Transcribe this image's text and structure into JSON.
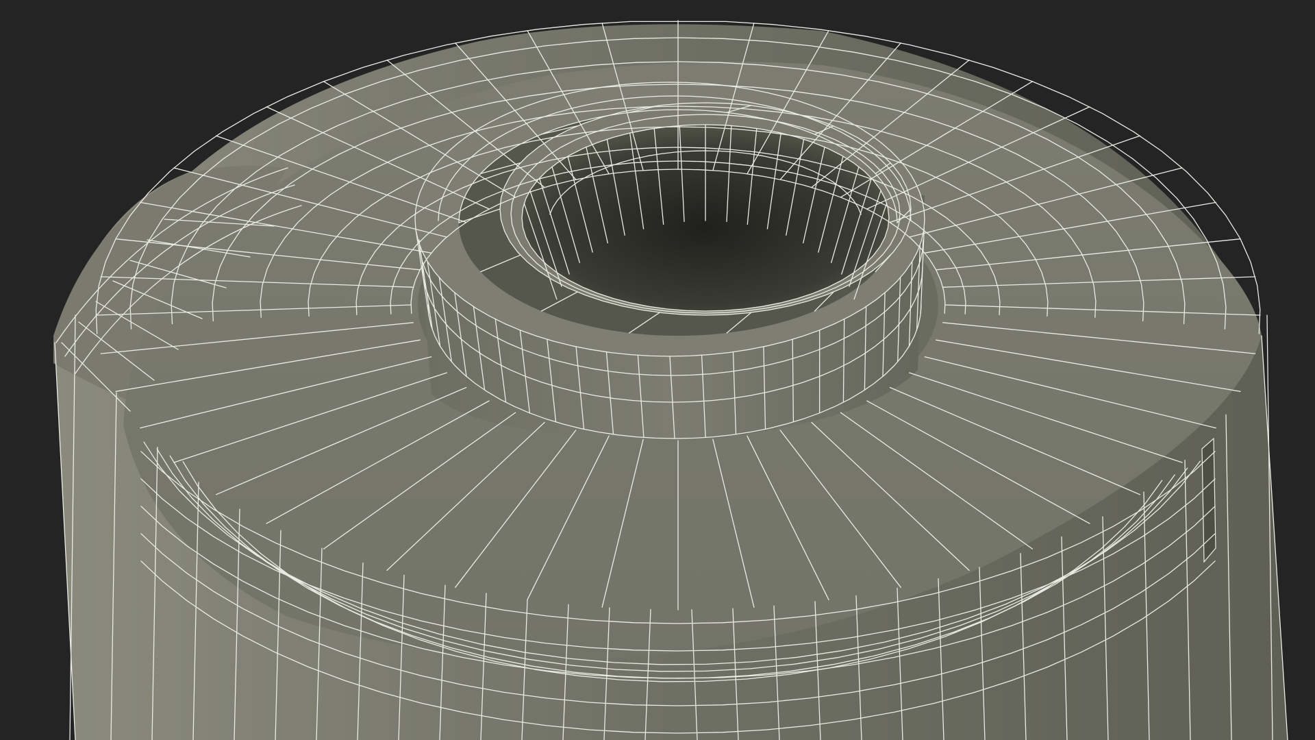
{
  "scene": {
    "subject": "wireframe-render-of-cylindrical-tank-top",
    "colors": {
      "background": "#242424",
      "surface": "#75766a",
      "surface_light": "#828374",
      "surface_dark": "#5d5e53",
      "interior": "#2f302a",
      "wire": "#ecece6"
    }
  }
}
